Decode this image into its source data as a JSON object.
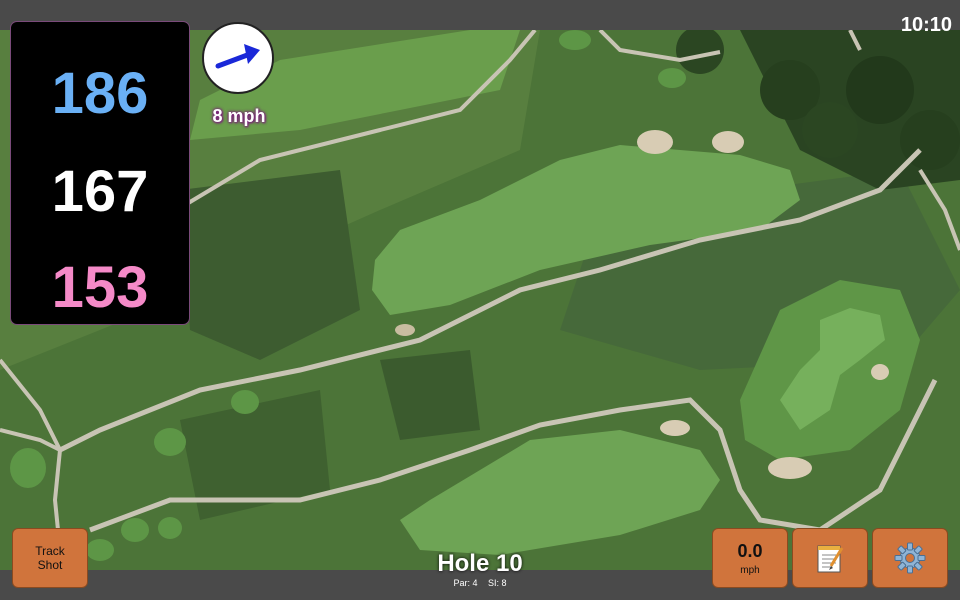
{
  "status": {
    "time": "10:10"
  },
  "distances": {
    "back": "186",
    "center": "167",
    "front": "153"
  },
  "wind": {
    "speed": "8 mph",
    "icon": "arrow-icon"
  },
  "buttons": {
    "track_shot": {
      "line1": "Track",
      "line2": "Shot"
    },
    "speed": {
      "value": "0.0",
      "unit": "mph"
    },
    "notes_icon": "notepad-icon",
    "settings_icon": "gear-icon"
  },
  "hole": {
    "title": "Hole 10",
    "par": "Par: 4",
    "si": "SI: 8"
  },
  "colors": {
    "back": "#6ab0f5",
    "center": "#ffffff",
    "front": "#f58ac8",
    "button": "#d0743c",
    "wind_arrow": "#1a28d8"
  }
}
